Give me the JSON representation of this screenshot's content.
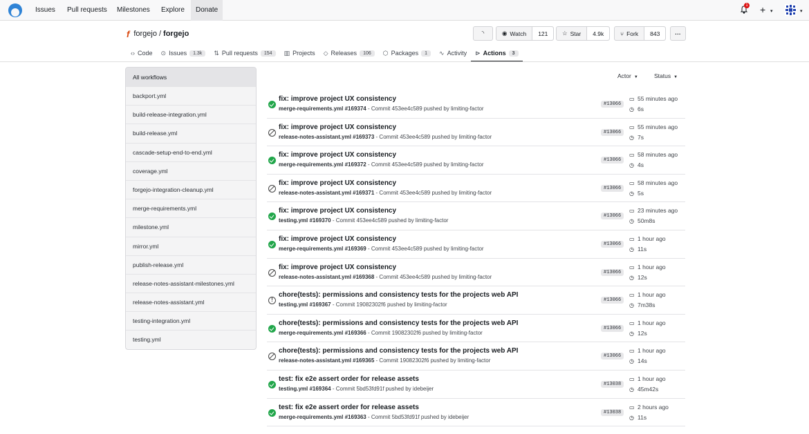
{
  "nav": {
    "issues": "Issues",
    "pulls": "Pull requests",
    "milestones": "Milestones",
    "explore": "Explore",
    "donate": "Donate",
    "notification_count": "1",
    "plus": "+"
  },
  "repo": {
    "owner": "forgejo",
    "separator": "/",
    "name": "forgejo",
    "watch_label": "Watch",
    "watch_count": "121",
    "star_label": "Star",
    "star_count": "4.9k",
    "fork_label": "Fork",
    "fork_count": "843",
    "more": "···"
  },
  "tabs": [
    {
      "label": "Code",
      "icon": "code-icon",
      "count": ""
    },
    {
      "label": "Issues",
      "icon": "issue-icon",
      "count": "1.3k"
    },
    {
      "label": "Pull requests",
      "icon": "pull-request-icon",
      "count": "154"
    },
    {
      "label": "Projects",
      "icon": "project-icon",
      "count": ""
    },
    {
      "label": "Releases",
      "icon": "tag-icon",
      "count": "106"
    },
    {
      "label": "Packages",
      "icon": "package-icon",
      "count": "1"
    },
    {
      "label": "Activity",
      "icon": "pulse-icon",
      "count": ""
    },
    {
      "label": "Actions",
      "icon": "play-icon",
      "count": "3"
    }
  ],
  "sidebar": {
    "items": [
      "All workflows",
      "backport.yml",
      "build-release-integration.yml",
      "build-release.yml",
      "cascade-setup-end-to-end.yml",
      "coverage.yml",
      "forgejo-integration-cleanup.yml",
      "merge-requirements.yml",
      "milestone.yml",
      "mirror.yml",
      "publish-release.yml",
      "release-notes-assistant-milestones.yml",
      "release-notes-assistant.yml",
      "testing-integration.yml",
      "testing.yml"
    ]
  },
  "filters": {
    "actor": "Actor",
    "status": "Status"
  },
  "runs": [
    {
      "status": "success",
      "title": "fix: improve project UX consistency",
      "workflow": "merge-requirements.yml #169374",
      "commit": "Commit 453ee4c589 pushed by limiting-factor",
      "ref": "#13066",
      "when": "55 minutes ago",
      "duration": "6s"
    },
    {
      "status": "skipped",
      "title": "fix: improve project UX consistency",
      "workflow": "release-notes-assistant.yml #169373",
      "commit": "Commit 453ee4c589 pushed by limiting-factor",
      "ref": "#13066",
      "when": "55 minutes ago",
      "duration": "7s"
    },
    {
      "status": "success",
      "title": "fix: improve project UX consistency",
      "workflow": "merge-requirements.yml #169372",
      "commit": "Commit 453ee4c589 pushed by limiting-factor",
      "ref": "#13066",
      "when": "58 minutes ago",
      "duration": "4s"
    },
    {
      "status": "skipped",
      "title": "fix: improve project UX consistency",
      "workflow": "release-notes-assistant.yml #169371",
      "commit": "Commit 453ee4c589 pushed by limiting-factor",
      "ref": "#13066",
      "when": "58 minutes ago",
      "duration": "5s"
    },
    {
      "status": "success",
      "title": "fix: improve project UX consistency",
      "workflow": "testing.yml #169370",
      "commit": "Commit 453ee4c589 pushed by limiting-factor",
      "ref": "#13066",
      "when": "23 minutes ago",
      "duration": "50m8s"
    },
    {
      "status": "success",
      "title": "fix: improve project UX consistency",
      "workflow": "merge-requirements.yml #169369",
      "commit": "Commit 453ee4c589 pushed by limiting-factor",
      "ref": "#13066",
      "when": "1 hour ago",
      "duration": "11s"
    },
    {
      "status": "skipped",
      "title": "fix: improve project UX consistency",
      "workflow": "release-notes-assistant.yml #169368",
      "commit": "Commit 453ee4c589 pushed by limiting-factor",
      "ref": "#13066",
      "when": "1 hour ago",
      "duration": "12s"
    },
    {
      "status": "failure",
      "title": "chore(tests): permissions and consistency tests for the projects web API",
      "workflow": "testing.yml #169367",
      "commit": "Commit 19082302f6 pushed by limiting-factor",
      "ref": "#13066",
      "when": "1 hour ago",
      "duration": "7m38s"
    },
    {
      "status": "success",
      "title": "chore(tests): permissions and consistency tests for the projects web API",
      "workflow": "merge-requirements.yml #169366",
      "commit": "Commit 19082302f6 pushed by limiting-factor",
      "ref": "#13066",
      "when": "1 hour ago",
      "duration": "12s"
    },
    {
      "status": "skipped",
      "title": "chore(tests): permissions and consistency tests for the projects web API",
      "workflow": "release-notes-assistant.yml #169365",
      "commit": "Commit 19082302f6 pushed by limiting-factor",
      "ref": "#13066",
      "when": "1 hour ago",
      "duration": "14s"
    },
    {
      "status": "success",
      "title": "test: fix e2e assert order for release assets",
      "workflow": "testing.yml #169364",
      "commit": "Commit 5bd53fd91f pushed by idebeijer",
      "ref": "#13038",
      "when": "1 hour ago",
      "duration": "45m42s"
    },
    {
      "status": "success",
      "title": "test: fix e2e assert order for release assets",
      "workflow": "merge-requirements.yml #169363",
      "commit": "Commit 5bd53fd91f pushed by idebeijer",
      "ref": "#13038",
      "when": "2 hours ago",
      "duration": "11s"
    }
  ]
}
